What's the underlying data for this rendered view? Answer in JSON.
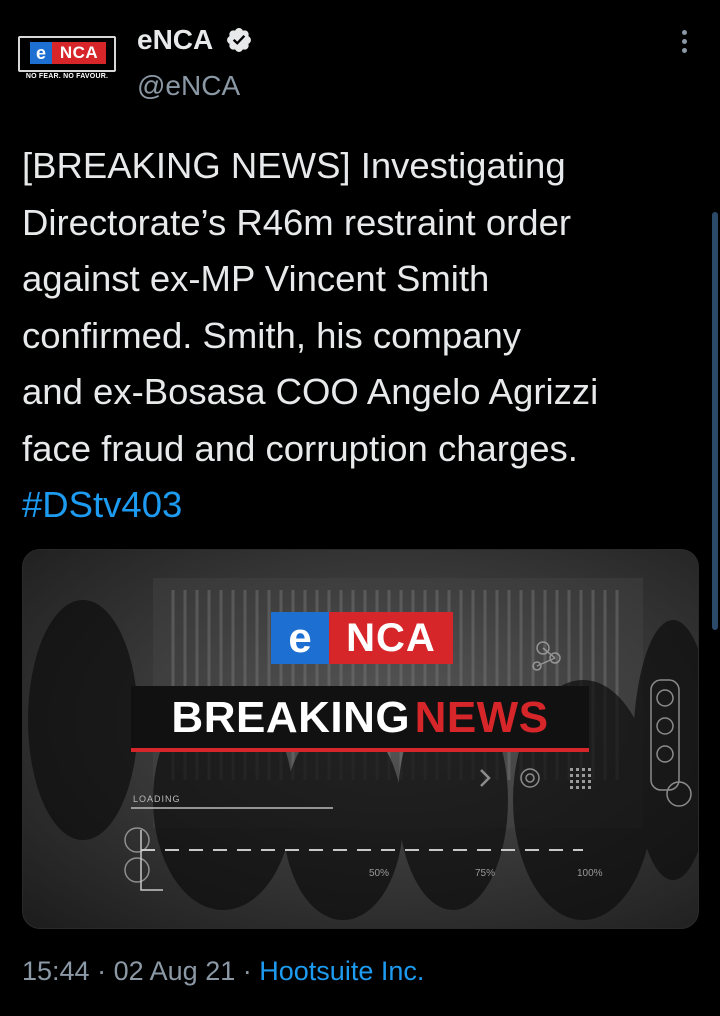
{
  "account": {
    "display_name": "eNCA",
    "handle": "@eNCA",
    "verified": true,
    "avatar": {
      "logo_e": "e",
      "logo_nca": "NCA",
      "tagline": "NO FEAR. NO FAVOUR."
    }
  },
  "tweet": {
    "lines": [
      "[BREAKING NEWS] Investigating",
      "Directorate’s R46m restraint order",
      "against ex-MP Vincent Smith",
      "confirmed. Smith, his company",
      "and ex-Bosasa COO Angelo Agrizzi",
      "face fraud and corruption charges."
    ],
    "hashtag": "#DStv403"
  },
  "media": {
    "logo_e": "e",
    "logo_nca": "NCA",
    "breaking_word": "BREAKING",
    "news_word": "NEWS",
    "loading_label": "LOADING",
    "percent_labels": [
      "50%",
      "75%",
      "100%"
    ]
  },
  "meta": {
    "time": "15:44",
    "separator": "·",
    "date": "02 Aug 21",
    "source": "Hootsuite Inc."
  },
  "colors": {
    "background": "#000000",
    "text": "#e7e9ea",
    "secondary": "#8b98a5",
    "link": "#1d9bf0",
    "brand_blue": "#1d6fd1",
    "brand_red": "#d7262a"
  },
  "icons": [
    "verified-badge-icon",
    "more-options-icon"
  ]
}
